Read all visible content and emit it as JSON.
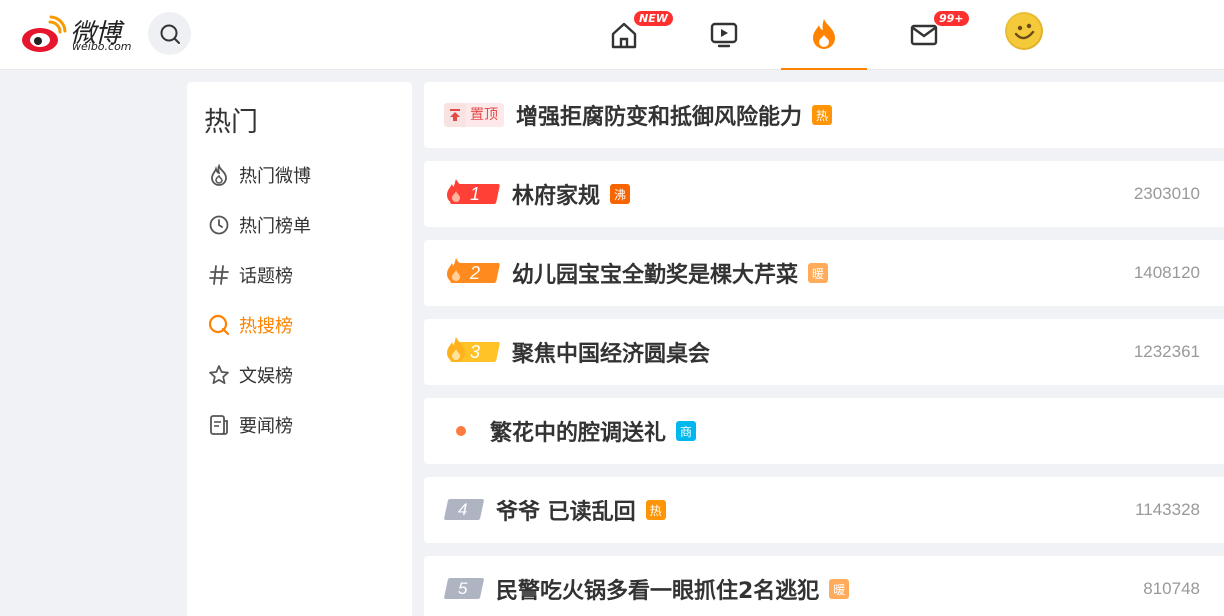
{
  "header": {
    "logo_text": "微博",
    "logo_domain": "weibo.com",
    "nav": [
      {
        "name": "home",
        "badge": "NEW"
      },
      {
        "name": "video",
        "badge": ""
      },
      {
        "name": "hot",
        "badge": ""
      },
      {
        "name": "messages",
        "badge": "99+"
      }
    ],
    "active_nav": "hot",
    "colors": {
      "accent": "#ff8200",
      "badge": "#fe2f2f"
    }
  },
  "sidebar": {
    "title": "热门",
    "items": [
      {
        "label": "热门微博",
        "icon": "flame-outline-icon",
        "active": false
      },
      {
        "label": "热门榜单",
        "icon": "clock-icon",
        "active": false
      },
      {
        "label": "话题榜",
        "icon": "hashtag-icon",
        "active": false
      },
      {
        "label": "热搜榜",
        "icon": "search-ring-icon",
        "active": true
      },
      {
        "label": "文娱榜",
        "icon": "star-icon",
        "active": false
      },
      {
        "label": "要闻榜",
        "icon": "news-icon",
        "active": false
      }
    ]
  },
  "list": [
    {
      "type": "pinned",
      "pin_label": "置顶",
      "text": "增强拒腐防变和抵御风险能力",
      "tag": "热",
      "tag_color": "#ff9406",
      "count": ""
    },
    {
      "type": "rank",
      "rank": "1",
      "text": "林府家规",
      "tag": "沸",
      "tag_color": "#f86400",
      "count": "2303010",
      "plate_color": "#fe4036"
    },
    {
      "type": "rank",
      "rank": "2",
      "text": "幼儿园宝宝全勤奖是棵大芹菜",
      "tag": "暖",
      "tag_color": "#ffab5a",
      "count": "1408120",
      "plate_color": "#ff8b1e"
    },
    {
      "type": "rank",
      "rank": "3",
      "text": "聚焦中国经济圆桌会",
      "tag": "",
      "tag_color": "",
      "count": "1232361",
      "plate_color": "#ffc227"
    },
    {
      "type": "ad",
      "text": "繁花中的腔调送礼",
      "tag": "商",
      "tag_color": "#00b7ee",
      "count": ""
    },
    {
      "type": "plain",
      "rank": "4",
      "text": "爷爷 已读乱回",
      "tag": "热",
      "tag_color": "#ff9406",
      "count": "1143328"
    },
    {
      "type": "plain",
      "rank": "5",
      "text": "民警吃火锅多看一眼抓住2名逃犯",
      "tag": "暖",
      "tag_color": "#ffab5a",
      "count": "810748"
    }
  ]
}
